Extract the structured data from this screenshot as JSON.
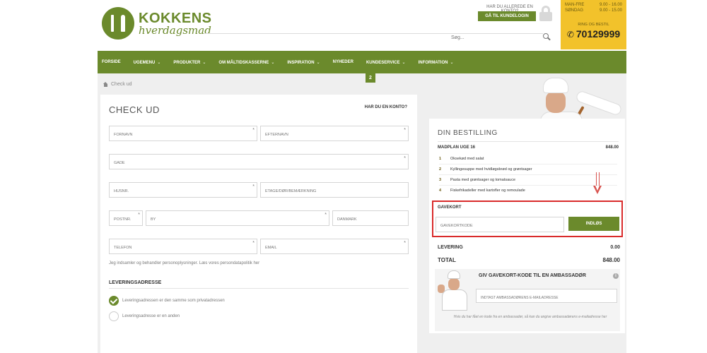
{
  "header": {
    "logo_main": "KOKKENS",
    "logo_sub": "hverdagsmad",
    "login_hint": "HAR DU ALLEREDE EN KONTO?",
    "login_button": "GÅ TIL KUNDELOGIN",
    "search_placeholder": "Søg...",
    "hours": [
      {
        "day": "MAN-FRE",
        "time": "9.00 - 16.00"
      },
      {
        "day": "SØNDAG",
        "time": "9.00 - 15.00"
      }
    ],
    "phone_label": "RING OG BESTIL",
    "phone_number": "70129999"
  },
  "nav": {
    "items": [
      {
        "label": "FORSIDE",
        "dropdown": false
      },
      {
        "label": "UGEMENU",
        "dropdown": true
      },
      {
        "label": "PRODUKTER",
        "dropdown": true
      },
      {
        "label": "OM MÅLTIDSKASSERNE",
        "dropdown": true
      },
      {
        "label": "INSPIRATION",
        "dropdown": true
      },
      {
        "label": "NYHEDER",
        "dropdown": false
      },
      {
        "label": "KUNDESERVICE",
        "dropdown": true
      },
      {
        "label": "INFORMATION",
        "dropdown": true
      }
    ],
    "cart_count": "2"
  },
  "breadcrumb": "Check ud",
  "checkout": {
    "title": "CHECK UD",
    "has_account": "HAR DU EN KONTO?",
    "fields": {
      "firstname": "FORNAVN",
      "lastname": "EFTERNAVN",
      "street": "GADE",
      "house_no": "HUSNR.",
      "floor": "ETAGE/DØR/BEMÆRKNING",
      "postal": "POSTNR.",
      "city": "BY",
      "country": "DANMARK",
      "phone": "TELEFON",
      "email": "EMAIL"
    },
    "privacy_text": "Jeg indsamler og behandler personoplysninger. Læs vores persondatapolitik her",
    "delivery_title": "LEVERINGSADRESSE",
    "delivery_same": "Leveringsadressen er den samme som privatadressen",
    "delivery_other": "Leveringsadresse er en anden"
  },
  "order": {
    "title": "DIN BESTILLING",
    "plan_name": "MADPLAN UGE 16",
    "plan_price": "848.00",
    "dishes": [
      {
        "n": "1",
        "name": "Oksekød med salat"
      },
      {
        "n": "2",
        "name": "Kyllingesuppe med hvidløgsbrød og grøntsager"
      },
      {
        "n": "3",
        "name": "Pasta med grøntsager og tomatsauce"
      },
      {
        "n": "4",
        "name": "Fiskefrikadeller med kartofler og remoulade"
      }
    ],
    "giftcard_label": "GAVEKORT",
    "giftcard_placeholder": "GAVEKORTKODE",
    "redeem_button": "INDLØS",
    "delivery_label": "LEVERING",
    "delivery_value": "0.00",
    "total_label": "TOTAL",
    "total_value": "848.00",
    "ambassador_title": "GIV GAVEKORT-KODE TIL EN AMBASSADØR",
    "ambassador_placeholder": "INDTAST AMBASSADØRENS E-MAILADRESSE",
    "ambassador_note": "Hvis du har fået en kode fra en ambassadør, så kan du angive ambassadørens e-mailadresse her"
  },
  "colors": {
    "brand_green": "#6b8a2c",
    "phone_yellow": "#f2c22b",
    "highlight_red": "#d92b2b"
  }
}
